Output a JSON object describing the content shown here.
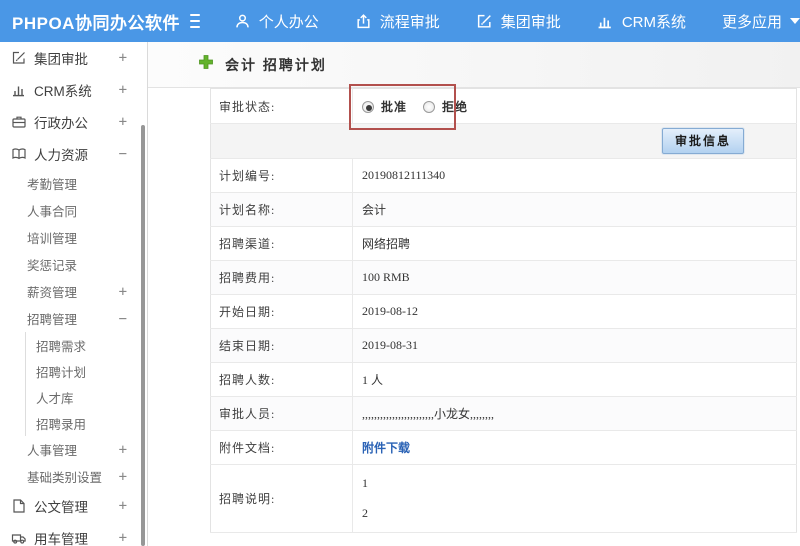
{
  "topbar": {
    "app_title": "PHPOA协同办公软件",
    "nav": [
      {
        "label": "个人办公",
        "icon": "user-icon"
      },
      {
        "label": "流程审批",
        "icon": "flow-icon"
      },
      {
        "label": "集团审批",
        "icon": "edit-icon"
      },
      {
        "label": "CRM系统",
        "icon": "chart-icon"
      },
      {
        "label": "更多应用",
        "icon": "caret-down-icon"
      }
    ]
  },
  "sidebar": {
    "items": [
      {
        "label": "集团审批",
        "icon": "edit-icon",
        "expand": "+",
        "level": "top"
      },
      {
        "label": "CRM系统",
        "icon": "chart-icon",
        "expand": "+",
        "level": "top"
      },
      {
        "label": "行政办公",
        "icon": "briefcase-icon",
        "expand": "+",
        "level": "top"
      },
      {
        "label": "人力资源",
        "icon": "book-icon",
        "expand": "−",
        "level": "top"
      },
      {
        "label": "考勤管理",
        "level": "sub"
      },
      {
        "label": "人事合同",
        "level": "sub"
      },
      {
        "label": "培训管理",
        "level": "sub"
      },
      {
        "label": "奖惩记录",
        "level": "sub"
      },
      {
        "label": "薪资管理",
        "expand": "+",
        "level": "sub"
      },
      {
        "label": "招聘管理",
        "expand": "−",
        "level": "sub"
      },
      {
        "label": "招聘需求",
        "level": "subsub"
      },
      {
        "label": "招聘计划",
        "level": "subsub"
      },
      {
        "label": "人才库",
        "level": "subsub"
      },
      {
        "label": "招聘录用",
        "level": "subsub"
      },
      {
        "label": "人事管理",
        "expand": "+",
        "level": "sub"
      },
      {
        "label": "基础类别设置",
        "expand": "+",
        "level": "sub"
      },
      {
        "label": "公文管理",
        "icon": "document-icon",
        "expand": "+",
        "level": "top"
      },
      {
        "label": "用车管理",
        "icon": "car-icon",
        "expand": "+",
        "level": "top"
      }
    ]
  },
  "main": {
    "page_title": "会计 招聘计划",
    "approval": {
      "status_label": "审批状态:",
      "options": [
        {
          "label": "批准",
          "selected": true
        },
        {
          "label": "拒绝",
          "selected": false
        }
      ],
      "button_label": "审批信息"
    },
    "fields": [
      {
        "label": "计划编号:",
        "value": "20190812111340"
      },
      {
        "label": "计划名称:",
        "value": "会计"
      },
      {
        "label": "招聘渠道:",
        "value": "网络招聘"
      },
      {
        "label": "招聘费用:",
        "value": "100 RMB"
      },
      {
        "label": "开始日期:",
        "value": "2019-08-12"
      },
      {
        "label": "结束日期:",
        "value": "2019-08-31"
      },
      {
        "label": "招聘人数:",
        "value": "1 人"
      },
      {
        "label": "审批人员:",
        "value": ",,,,,,,,,,,,,,,,,,,,,,,,小龙女,,,,,,,,"
      },
      {
        "label": "附件文档:",
        "value": "附件下载",
        "type": "link"
      },
      {
        "label": "招聘说明:",
        "value_lines": [
          "1",
          "2"
        ],
        "type": "multiline"
      }
    ]
  },
  "colors": {
    "topbar_blue": "#4a97e6",
    "annotation_red": "#b2504d",
    "link_blue": "#2a62b5",
    "plus_green": "#63b32c",
    "button_face": "#b2d1f0"
  }
}
